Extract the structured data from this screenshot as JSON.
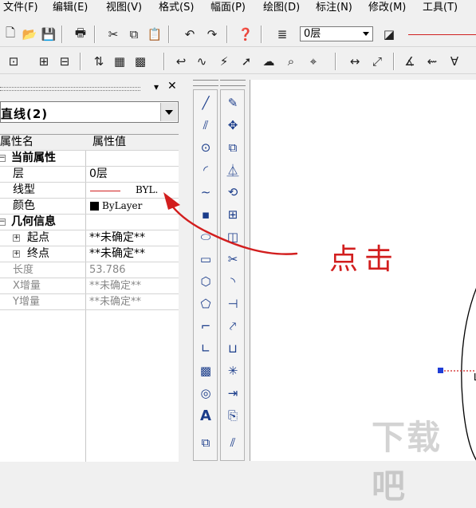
{
  "menu": [
    "文件(F)",
    "编辑(E)",
    "视图(V)",
    "格式(S)",
    "幅面(P)",
    "绘图(D)",
    "标注(N)",
    "修改(M)",
    "工具(T)"
  ],
  "toolbar": {
    "layer_value": "0层"
  },
  "properties": {
    "object_type": "直线(2)",
    "header_name": "属性名",
    "header_value": "属性值",
    "group_current": "当前属性",
    "layer_label": "层",
    "layer_value": "0层",
    "linetype_label": "线型",
    "linetype_value": "BYL.",
    "color_label": "颜色",
    "color_value": "ByLayer",
    "group_geometry": "几何信息",
    "start_label": "起点",
    "start_value": "**未确定**",
    "end_label": "终点",
    "end_value": "**未确定**",
    "length_label": "长度",
    "length_value": "53.786",
    "xinc_label": "X增量",
    "xinc_value": "**未确定**",
    "yinc_label": "Y增量",
    "yinc_value": "**未确定**"
  },
  "annotation": "点击",
  "watermark": "下载吧",
  "colors": {
    "accent_red": "#d21e1e",
    "linetype_red": "#d02020"
  }
}
